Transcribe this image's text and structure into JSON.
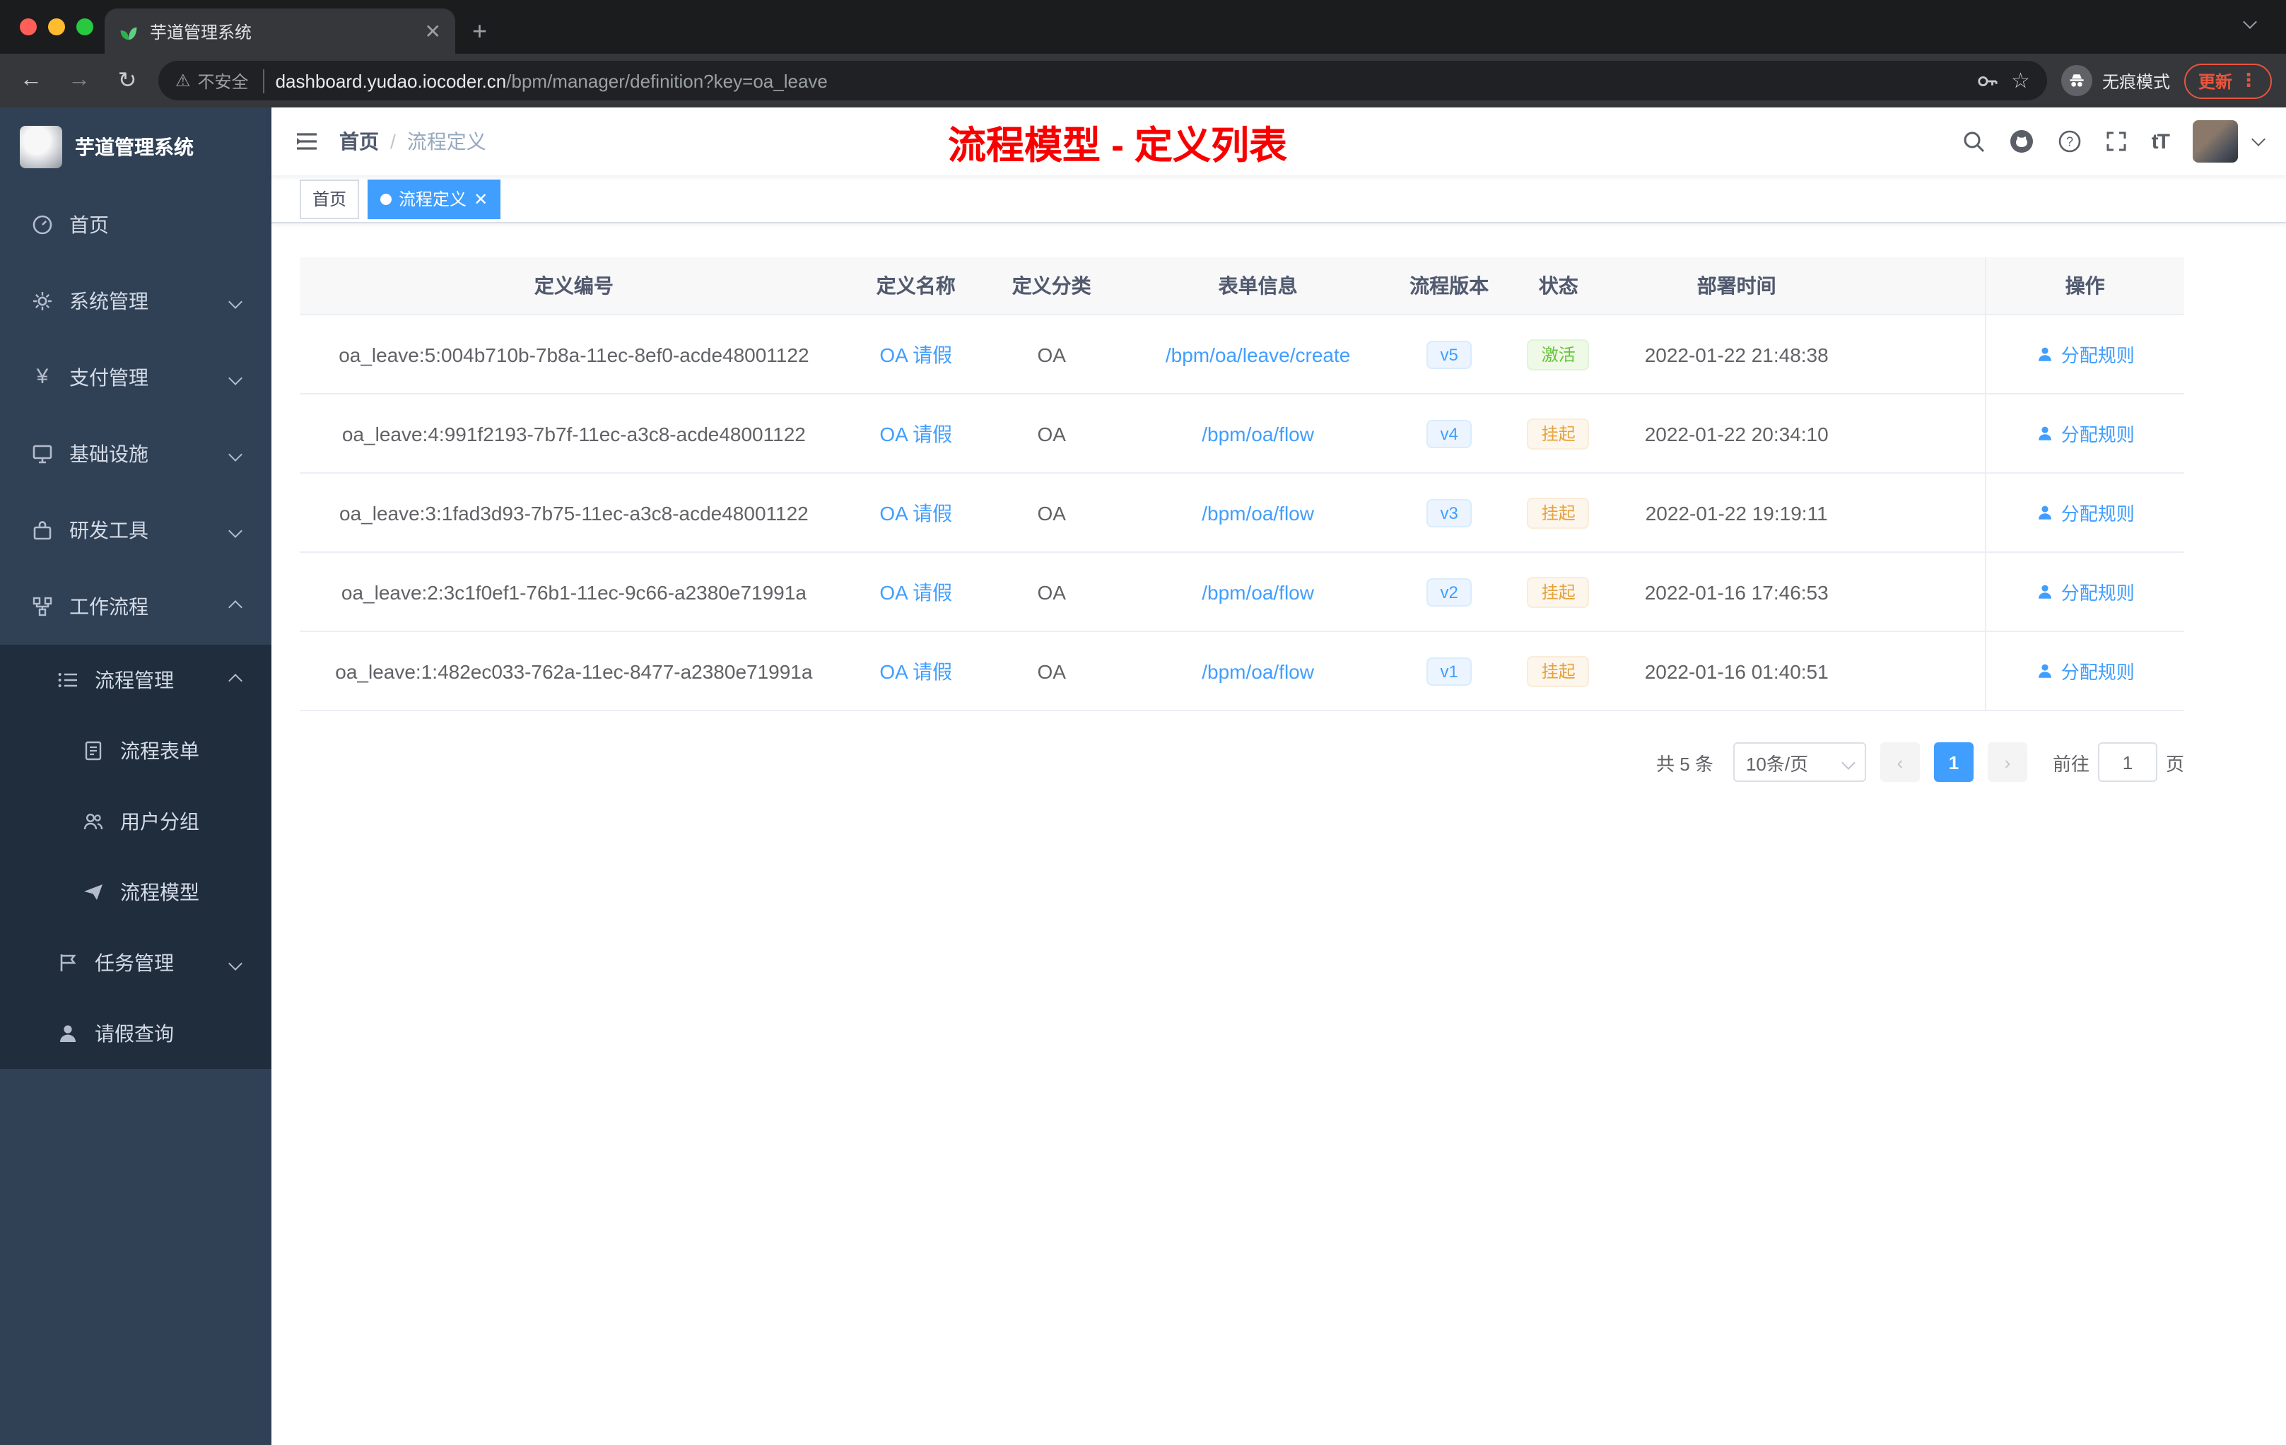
{
  "browser": {
    "tab_title": "芋道管理系统",
    "security_label": "不安全",
    "url_host": "dashboard.yudao.iocoder.cn",
    "url_path": "/bpm/manager/definition?key=oa_leave",
    "incognito_label": "无痕模式",
    "update_label": "更新"
  },
  "sidebar": {
    "logo_title": "芋道管理系统",
    "items": [
      {
        "label": "首页"
      },
      {
        "label": "系统管理"
      },
      {
        "label": "支付管理"
      },
      {
        "label": "基础设施"
      },
      {
        "label": "研发工具"
      },
      {
        "label": "工作流程"
      }
    ],
    "workflow": {
      "process_mgmt": "流程管理",
      "process_children": [
        {
          "label": "流程表单"
        },
        {
          "label": "用户分组"
        },
        {
          "label": "流程模型"
        }
      ],
      "task_mgmt": "任务管理",
      "leave_query": "请假查询"
    }
  },
  "header": {
    "breadcrumb_home": "首页",
    "breadcrumb_sep": "/",
    "breadcrumb_current": "流程定义",
    "page_title": "流程模型 - 定义列表",
    "font_size_icon": "tT"
  },
  "tags": {
    "home": "首页",
    "active": "流程定义"
  },
  "table": {
    "columns": [
      "定义编号",
      "定义名称",
      "定义分类",
      "表单信息",
      "流程版本",
      "状态",
      "部署时间",
      "操作"
    ],
    "action_label": "分配规则",
    "rows": [
      {
        "id": "oa_leave:5:004b710b-7b8a-11ec-8ef0-acde48001122",
        "name": "OA 请假",
        "category": "OA",
        "form": "/bpm/oa/leave/create",
        "version": "v5",
        "status": "激活",
        "status_type": "success",
        "time": "2022-01-22 21:48:38"
      },
      {
        "id": "oa_leave:4:991f2193-7b7f-11ec-a3c8-acde48001122",
        "name": "OA 请假",
        "category": "OA",
        "form": "/bpm/oa/flow",
        "version": "v4",
        "status": "挂起",
        "status_type": "warning",
        "time": "2022-01-22 20:34:10"
      },
      {
        "id": "oa_leave:3:1fad3d93-7b75-11ec-a3c8-acde48001122",
        "name": "OA 请假",
        "category": "OA",
        "form": "/bpm/oa/flow",
        "version": "v3",
        "status": "挂起",
        "status_type": "warning",
        "time": "2022-01-22 19:19:11"
      },
      {
        "id": "oa_leave:2:3c1f0ef1-76b1-11ec-9c66-a2380e71991a",
        "name": "OA 请假",
        "category": "OA",
        "form": "/bpm/oa/flow",
        "version": "v2",
        "status": "挂起",
        "status_type": "warning",
        "time": "2022-01-16 17:46:53"
      },
      {
        "id": "oa_leave:1:482ec033-762a-11ec-8477-a2380e71991a",
        "name": "OA 请假",
        "category": "OA",
        "form": "/bpm/oa/flow",
        "version": "v1",
        "status": "挂起",
        "status_type": "warning",
        "time": "2022-01-16 01:40:51"
      }
    ]
  },
  "pagination": {
    "total": "共 5 条",
    "page_size": "10条/页",
    "current_page": "1",
    "goto_label": "前往",
    "goto_value": "1",
    "unit_label": "页"
  },
  "palette": {
    "accent": "#409eff",
    "title_red": "#f80000",
    "success": "#67c23a",
    "warning": "#e6a23c",
    "sidebar_bg": "#304156",
    "submenu_bg": "#1f2d3d"
  }
}
